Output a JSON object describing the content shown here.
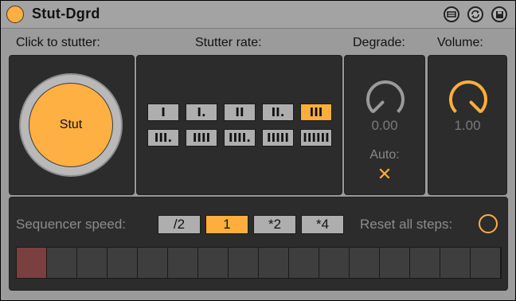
{
  "window": {
    "title": "Stut-Dgrd"
  },
  "labels": {
    "click_to_stutter": "Click to stutter:",
    "stutter_rate": "Stutter rate:",
    "degrade": "Degrade:",
    "volume": "Volume:",
    "auto": "Auto:",
    "auto_mark": "✕",
    "sequencer_speed": "Sequencer speed:",
    "reset_all_steps": "Reset all steps:"
  },
  "stut_button": {
    "label": "Stut"
  },
  "stutter_rates": [
    {
      "label": "I",
      "selected": false
    },
    {
      "label": "I.",
      "selected": false
    },
    {
      "label": "II",
      "selected": false
    },
    {
      "label": "II.",
      "selected": false
    },
    {
      "label": "III",
      "selected": true
    },
    {
      "label": "III.",
      "selected": false
    },
    {
      "label": "IIII",
      "selected": false
    },
    {
      "label": "IIII.",
      "selected": false
    },
    {
      "label": "IIIII",
      "selected": false
    },
    {
      "label": "IIIIII",
      "selected": false
    }
  ],
  "degrade": {
    "value": "0.00",
    "level": 0.0,
    "color": "#9a9a9a"
  },
  "volume": {
    "value": "1.00",
    "level": 1.0,
    "color": "#ffae3d"
  },
  "sequencer_speeds": [
    {
      "label": "/2",
      "selected": false
    },
    {
      "label": "1",
      "selected": true
    },
    {
      "label": "*2",
      "selected": false
    },
    {
      "label": "*4",
      "selected": false
    }
  ],
  "steps": [
    true,
    false,
    false,
    false,
    false,
    false,
    false,
    false,
    false,
    false,
    false,
    false,
    false,
    false,
    false,
    false
  ],
  "colors": {
    "accent": "#ffae3d",
    "step_active": "#7a3f3f",
    "panel": "#2c2c2c"
  }
}
